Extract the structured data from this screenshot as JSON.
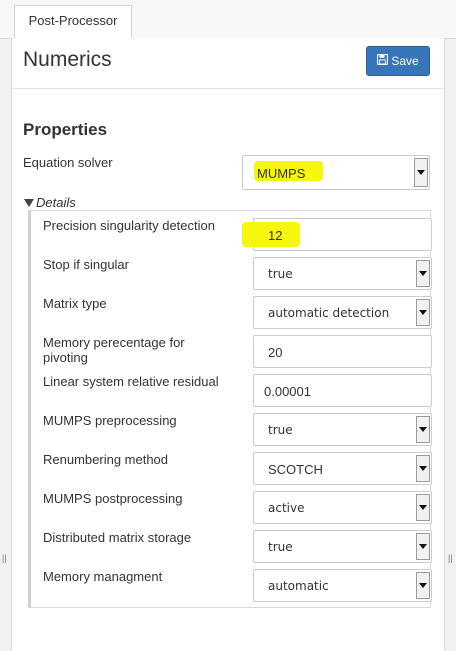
{
  "tabs": [
    {
      "label": "Post-Processor"
    }
  ],
  "header": {
    "title": "Numerics",
    "save_label": "Save"
  },
  "properties": {
    "section_title": "Properties",
    "equation_solver": {
      "label": "Equation solver",
      "value": "MUMPS"
    }
  },
  "details": {
    "toggle_label": "Details",
    "rows": [
      {
        "label": "Precision singularity detection",
        "value": "12"
      },
      {
        "label": "Stop if singular",
        "value": "true"
      },
      {
        "label": "Matrix type",
        "value": "automatic detection"
      },
      {
        "label": "Memory perecentage for pivoting",
        "value": "20"
      },
      {
        "label": "Linear system relative residual",
        "value": "0.00001"
      },
      {
        "label": "MUMPS preprocessing",
        "value": "true"
      },
      {
        "label": "Renumbering method",
        "value": "SCOTCH"
      },
      {
        "label": "MUMPS postprocessing",
        "value": "active"
      },
      {
        "label": "Distributed matrix storage",
        "value": "true"
      },
      {
        "label": "Memory managment",
        "value": "automatic"
      }
    ]
  },
  "colors": {
    "accent": "#3575b8",
    "highlight": "#f7f700"
  }
}
